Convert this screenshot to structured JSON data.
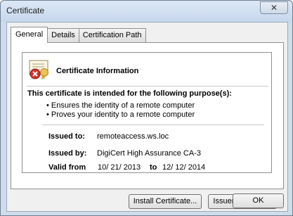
{
  "window": {
    "title": "Certificate",
    "close_glyph": "✕"
  },
  "tabs": [
    {
      "label": "General",
      "active": true
    },
    {
      "label": "Details",
      "active": false
    },
    {
      "label": "Certification Path",
      "active": false
    }
  ],
  "certificate": {
    "info_title": "Certificate Information",
    "purpose_title": "This certificate is intended for the following purpose(s):",
    "purposes": [
      "Ensures the identity of a remote computer",
      "Proves your identity to a remote computer"
    ],
    "issued_to_label": "Issued to:",
    "issued_to": "remoteaccess.ws.loc",
    "issued_by_label": "Issued by:",
    "issued_by": "DigiCert High Assurance CA-3",
    "valid_from_label": "Valid from",
    "valid_from": "10/ 21/ 2013",
    "valid_to_label": "to",
    "valid_to": "12/ 12/ 2014",
    "icon": "certificate-error-icon"
  },
  "buttons": {
    "install": "Install Certificate...",
    "issuer_statement": "Issuer Statement",
    "ok": "OK"
  }
}
